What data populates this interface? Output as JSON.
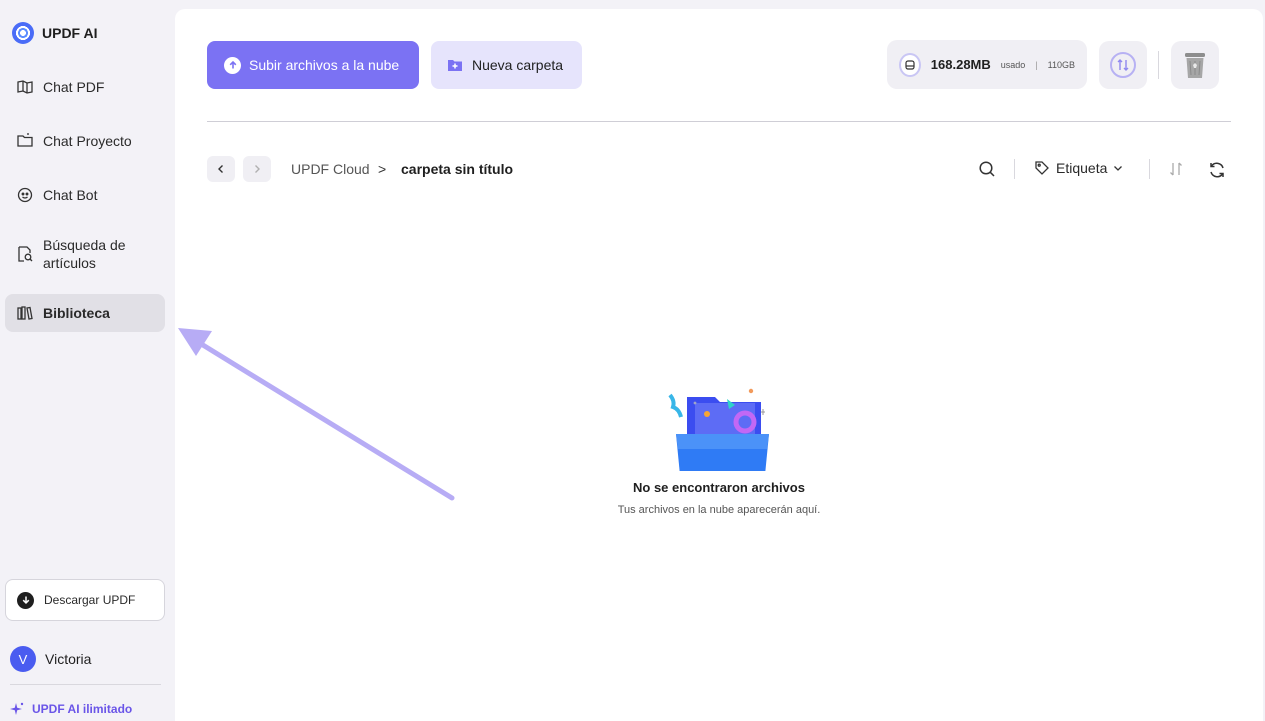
{
  "app": {
    "name": "UPDF AI"
  },
  "sidebar": {
    "items": [
      {
        "label": "Chat PDF",
        "icon": "book-icon"
      },
      {
        "label": "Chat Proyecto",
        "icon": "folder-chat-icon"
      },
      {
        "label": "Chat Bot",
        "icon": "bot-icon"
      },
      {
        "label": "Búsqueda de artículos",
        "icon": "search-doc-icon"
      },
      {
        "label": "Biblioteca",
        "icon": "library-icon",
        "active": true
      }
    ],
    "download_label": "Descargar UPDF",
    "user_initial": "V",
    "user_name": "Victoria",
    "promo_label": "UPDF AI ilimitado"
  },
  "toolbar": {
    "upload_label": "Subir archivos a la nube",
    "new_folder_label": "Nueva carpeta",
    "storage_used": "168.28MB",
    "storage_used_label": "usado",
    "storage_separator": "|",
    "storage_total": "110GB"
  },
  "breadcrumb": {
    "root": "UPDF Cloud",
    "separator": ">",
    "current": "carpeta sin título"
  },
  "filters": {
    "tag_label": "Etiqueta"
  },
  "empty_state": {
    "title": "No se encontraron archivos",
    "subtitle": "Tus archivos en la nube aparecerán aquí."
  },
  "colors": {
    "accent": "#7b72f3",
    "accent_light": "#e6e4fc",
    "sidebar_bg": "#f3f2f7",
    "annotation_arrow": "#b7acf5",
    "folder_blue": "#3b6cf6"
  }
}
